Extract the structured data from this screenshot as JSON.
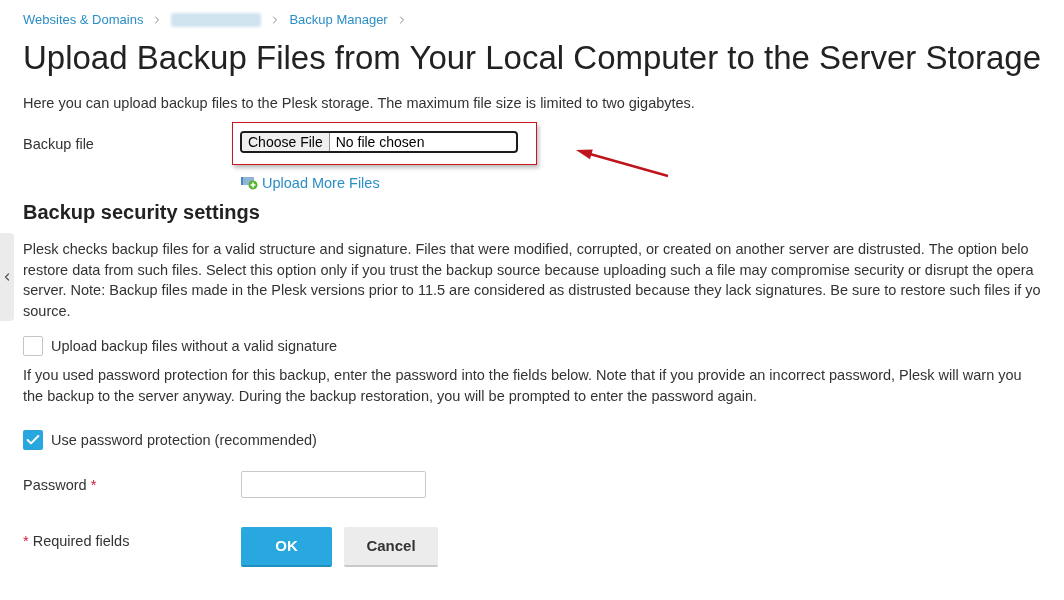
{
  "breadcrumbs": [
    {
      "kind": "link",
      "label": "Websites & Domains"
    },
    {
      "kind": "blurred"
    },
    {
      "kind": "link",
      "label": "Backup Manager"
    }
  ],
  "title": "Upload Backup Files from Your Local Computer to the Server Storage",
  "intro": "Here you can upload backup files to the Plesk storage. The maximum file size is limited to two gigabytes.",
  "backup_file": {
    "label": "Backup file",
    "button": "Choose File",
    "status": "No file chosen",
    "highlighted": true,
    "pointer_arrow": true
  },
  "upload_more": "Upload More Files",
  "security_section": {
    "heading": "Backup security settings",
    "description_lines": [
      "Plesk checks backup files for a valid structure and signature. Files that were modified, corrupted, or created on another server are distrusted. The option belo",
      "restore data from such files. Select this option only if you trust the backup source because uploading such a file may compromise security or disrupt the opera",
      "server. Note: Backup files made in the Plesk versions prior to 11.5 are considered as distrusted because they lack signatures. Be sure to restore such files if yo",
      "source."
    ],
    "unsigned_option": {
      "label": "Upload backup files without a valid signature",
      "checked": false
    },
    "password_note_lines": [
      "If you used password protection for this backup, enter the password into the fields below. Note that if you provide an incorrect password, Plesk will warn you",
      "the backup to the server anyway. During the backup restoration, you will be prompted to enter the password again."
    ],
    "password_option": {
      "label": "Use password protection (recommended)",
      "checked": true
    }
  },
  "password": {
    "label": "Password",
    "required_mark": "*"
  },
  "required_note": {
    "mark": "*",
    "text": "Required fields"
  },
  "buttons": [
    {
      "kind": "primary",
      "label": "OK"
    },
    {
      "kind": "secondary",
      "label": "Cancel"
    }
  ]
}
